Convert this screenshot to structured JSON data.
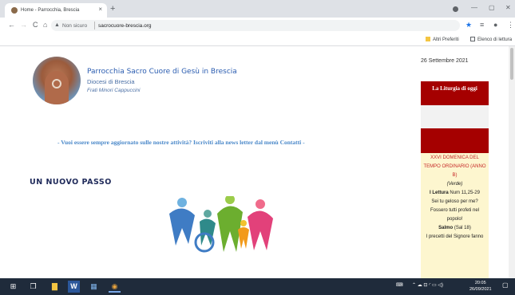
{
  "browser": {
    "tab_title": "Home - Parrocchia, Brescia",
    "tab_close": "×",
    "new_tab": "+",
    "nav": {
      "back": "←",
      "forward": "→",
      "reload": "C",
      "home": "⌂"
    },
    "security_label": "Non sicuro",
    "url": "sacrocuore-brescia.org",
    "window_controls": {
      "minimize": "—",
      "maximize": "▢",
      "close": "✕"
    },
    "toolbar_icons": {
      "bookmark_star": "★",
      "reading_list": "≡",
      "profile": "●",
      "menu": "⋮"
    },
    "bookmarks": {
      "other": "Altri Preferiti",
      "reading": "Elenco di lettura"
    }
  },
  "site": {
    "title": "Parrocchia Sacro Cuore di Gesù in Brescia",
    "diocese": "Diocesi di Brescia",
    "order": "Frati Minori Cappuccini",
    "date": "26 Settembre 2021",
    "marquee": "- Vuoi essere sempre aggiornato sulle nostre attività? Iscriviti alla news letter dal menù Contatti -",
    "heading": "UN NUOVO PASSO"
  },
  "liturgy": {
    "header": "La Liturgia di oggi",
    "sunday_line1": "XXVI DOMENICA DEL",
    "sunday_line2": "TEMPO ORDINARIO (ANNO",
    "sunday_line3": "B)",
    "color": "(Verde)",
    "reading_label": "I Lettura",
    "reading_ref": " Num 11,25-29",
    "reading_l1": "Sei tu geloso per me?",
    "reading_l2": "Fossero tutti profeti nel",
    "reading_l3": "popolo!",
    "psalm_label": "Salmo",
    "psalm_ref": " (Sal 18)",
    "psalm_l1": "I precetti del Signore fanno"
  },
  "taskbar": {
    "start": "⊞",
    "taskview": "❐",
    "explorer": "▇",
    "word": "W",
    "app": "▦",
    "chrome": "◉",
    "tray_icons": "⌃  ☁  ⊡  ◜  ▭  ◁)",
    "keyboard": "⌨",
    "time": "20:05",
    "date": "26/09/2021",
    "notifications": "▢"
  },
  "colors": {
    "accent_blue": "#2a5cb0",
    "liturgy_red": "#a50000",
    "liturgy_bg": "#fdf6cf",
    "taskbar_bg": "#1f2b3b"
  }
}
